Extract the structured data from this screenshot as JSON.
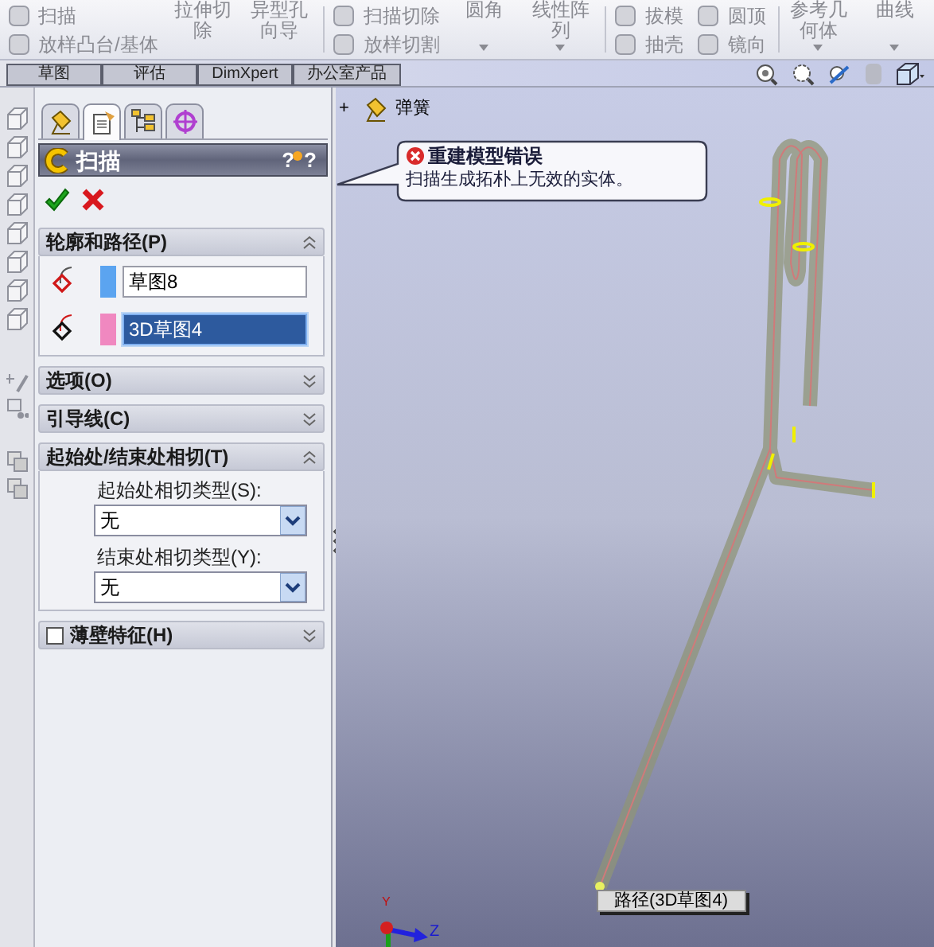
{
  "toolbar": {
    "groups": [
      {
        "items": [
          {
            "kind": "small",
            "label": "扫描",
            "disabled": true
          },
          {
            "kind": "small",
            "label": "放样凸台/基体",
            "disabled": true
          }
        ]
      },
      {
        "items": [
          {
            "kind": "large",
            "label": "拉伸切除",
            "disabled": true,
            "has_menu": false
          },
          {
            "kind": "large",
            "label": "异型孔向导",
            "disabled": true,
            "has_menu": false
          }
        ]
      },
      {
        "items": [
          {
            "kind": "small",
            "label": "扫描切除",
            "disabled": true
          },
          {
            "kind": "small",
            "label": "放样切割",
            "disabled": true
          }
        ]
      },
      {
        "items": [
          {
            "kind": "large",
            "label": "圆角",
            "disabled": true,
            "has_menu": true
          },
          {
            "kind": "large",
            "label": "线性阵列",
            "disabled": true,
            "has_menu": true
          }
        ]
      },
      {
        "items": [
          {
            "kind": "small",
            "label": "拔模",
            "disabled": true
          },
          {
            "kind": "small",
            "label": "抽壳",
            "disabled": true
          }
        ]
      },
      {
        "items": [
          {
            "kind": "small",
            "label": "圆顶",
            "disabled": true
          },
          {
            "kind": "small",
            "label": "镜向",
            "disabled": true
          }
        ]
      },
      {
        "items": [
          {
            "kind": "large",
            "label": "参考几何体",
            "disabled": true,
            "has_menu": true
          },
          {
            "kind": "large",
            "label": "曲线",
            "disabled": true,
            "has_menu": true
          }
        ]
      }
    ]
  },
  "command_tabs": [
    {
      "label": "草图",
      "selected": false
    },
    {
      "label": "评估",
      "selected": false
    },
    {
      "label": "DimXpert",
      "selected": false
    },
    {
      "label": "办公室产品",
      "selected": false
    }
  ],
  "panel_tabs": [
    {
      "selected": false
    },
    {
      "selected": true
    },
    {
      "selected": false
    },
    {
      "selected": false
    }
  ],
  "property_manager": {
    "title": "扫描",
    "help_buttons": [
      "?",
      "?"
    ],
    "sections": [
      {
        "kind": "profile_path",
        "title": "轮廓和路径(P)",
        "expanded": true,
        "fields": [
          {
            "value": "草图8",
            "color": "#5ba4f0",
            "selected": false
          },
          {
            "value": "3D草图4",
            "color": "#f088c0",
            "selected": true
          }
        ]
      },
      {
        "kind": "plain",
        "title": "选项(O)",
        "expanded": false
      },
      {
        "kind": "plain",
        "title": "引导线(C)",
        "expanded": false
      },
      {
        "kind": "tangency",
        "title": "起始处/结束处相切(T)",
        "expanded": true,
        "dropdowns": [
          {
            "label": "起始处相切类型(S):",
            "value": "无"
          },
          {
            "label": "结束处相切类型(Y):",
            "value": "无"
          }
        ]
      },
      {
        "kind": "checkbox",
        "title": "薄壁特征(H)",
        "expanded": false,
        "checked": false
      }
    ]
  },
  "viewport": {
    "tree_item": {
      "expander": "+",
      "label": "弹簧"
    },
    "error_callout": {
      "title": "重建模型错误",
      "message": "扫描生成拓朴上无效的实体。"
    },
    "path_label": "路径(3D草图4)",
    "axes": [
      "Y",
      "Z"
    ]
  }
}
